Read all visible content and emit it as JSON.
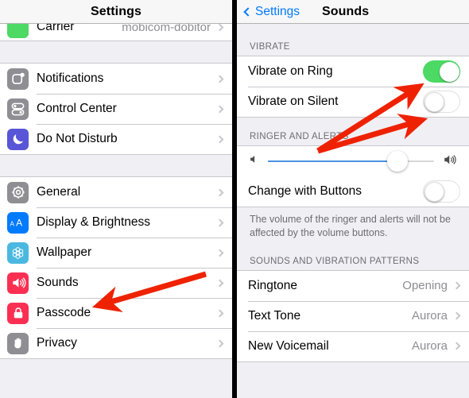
{
  "left_panel": {
    "nav": {
      "title": "Settings"
    },
    "carrier_row": {
      "label": "Carrier",
      "value": "mobicom-dobitor"
    },
    "group1": [
      {
        "label": "Notifications",
        "icon": "notifications-icon",
        "icon_color": "#8e8e93"
      },
      {
        "label": "Control Center",
        "icon": "control-center-icon",
        "icon_color": "#8e8e93"
      },
      {
        "label": "Do Not Disturb",
        "icon": "moon-icon",
        "icon_color": "#5856d6"
      }
    ],
    "group2": [
      {
        "label": "General",
        "icon": "gear-icon",
        "icon_color": "#8e8e93"
      },
      {
        "label": "Display & Brightness",
        "icon": "text-size-icon",
        "icon_color": "#007aff"
      },
      {
        "label": "Wallpaper",
        "icon": "flower-icon",
        "icon_color": "#4ab8e0"
      },
      {
        "label": "Sounds",
        "icon": "speaker-icon",
        "icon_color": "#fb2f52"
      },
      {
        "label": "Passcode",
        "icon": "lock-icon",
        "icon_color": "#fb2f52"
      },
      {
        "label": "Privacy",
        "icon": "hand-icon",
        "icon_color": "#8e8e93"
      }
    ]
  },
  "right_panel": {
    "nav": {
      "back_label": "Settings",
      "title": "Sounds"
    },
    "vibrate": {
      "header": "VIBRATE",
      "rows": [
        {
          "label": "Vibrate on Ring",
          "state": "on"
        },
        {
          "label": "Vibrate on Silent",
          "state": "off"
        }
      ]
    },
    "ringer": {
      "header": "RINGER AND ALERTS",
      "slider": {
        "value": 78,
        "min_icon": "speaker-low-icon",
        "max_icon": "speaker-high-icon"
      },
      "change_with_buttons": {
        "label": "Change with Buttons",
        "state": "off"
      },
      "footer": "The volume of the ringer and alerts will not be affected by the volume buttons."
    },
    "patterns": {
      "header": "SOUNDS AND VIBRATION PATTERNS",
      "rows": [
        {
          "label": "Ringtone",
          "value": "Opening"
        },
        {
          "label": "Text Tone",
          "value": "Aurora"
        },
        {
          "label": "New Voicemail",
          "value": "Aurora"
        }
      ]
    }
  },
  "annotations": {
    "arrow_color": "#ef2200",
    "arrows": [
      {
        "name": "arrow-to-sounds",
        "target": "Sounds"
      },
      {
        "name": "arrow-to-vibrate-on-ring",
        "target": "Vibrate on Ring toggle"
      },
      {
        "name": "arrow-to-vibrate-on-silent",
        "target": "Vibrate on Silent toggle"
      }
    ]
  },
  "colors": {
    "accent_blue": "#007aff",
    "toggle_on_green": "#4cd964",
    "slider_blue": "#4a90e2",
    "group_bg": "#efeff4",
    "separator": "#c8c7cc"
  }
}
